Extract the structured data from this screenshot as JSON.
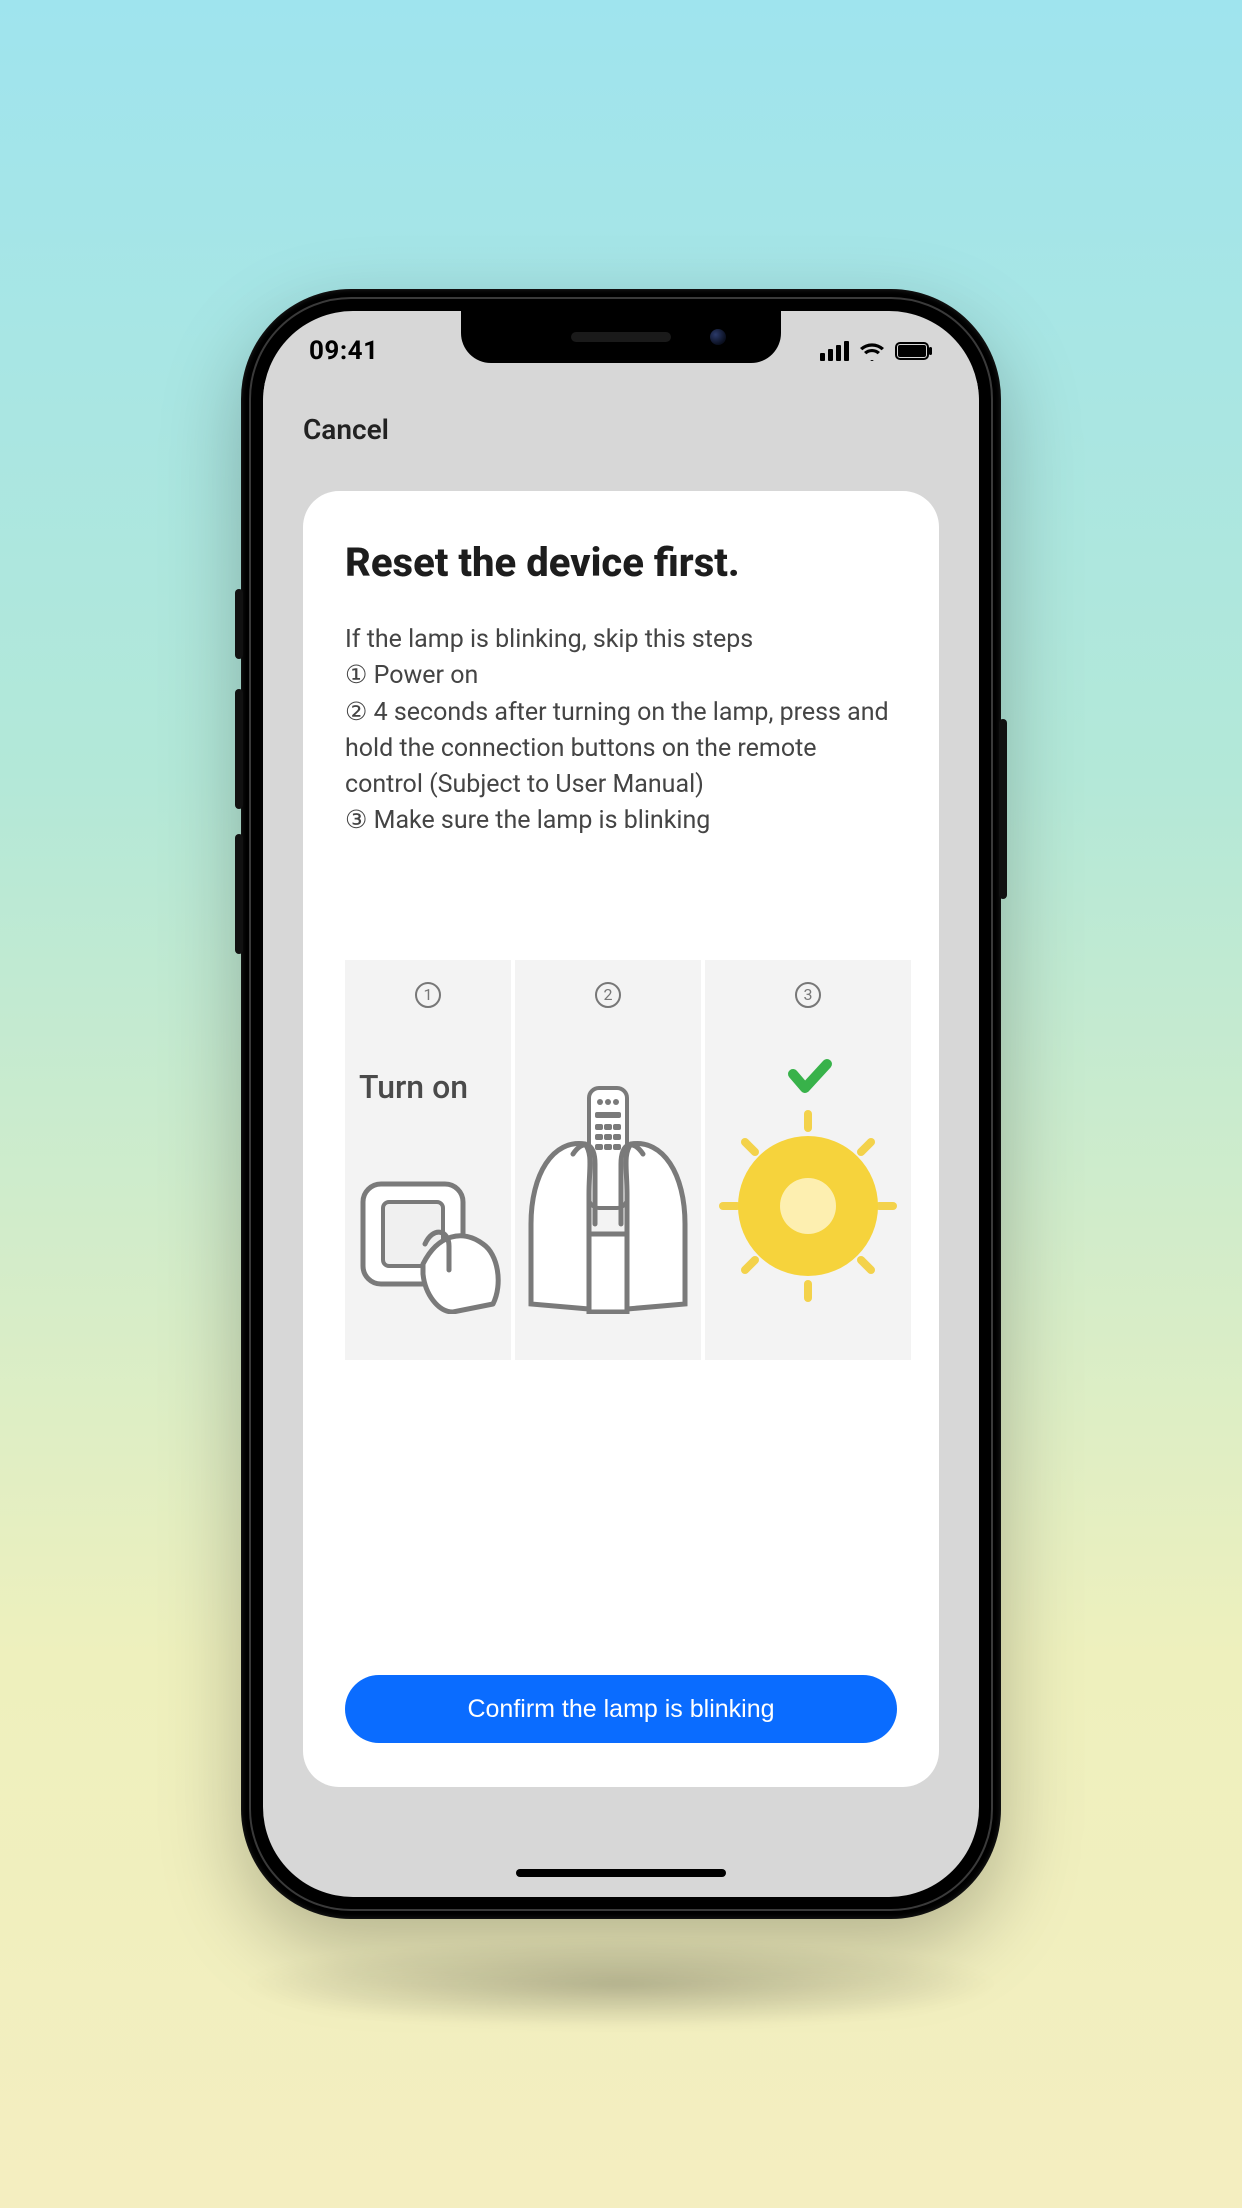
{
  "statusbar": {
    "time": "09:41"
  },
  "nav": {
    "cancel": "Cancel"
  },
  "card": {
    "title": "Reset the device first.",
    "body_line0": "If the lamp is blinking, skip this steps",
    "body_line1": "①  Power on",
    "body_line2": "②  4 seconds after turning on the lamp, press and hold the connection buttons on the remote control (Subject to User Manual)",
    "body_line3": "③  Make sure the lamp is blinking"
  },
  "tiles": {
    "t1": {
      "num": "1",
      "label": "Turn on"
    },
    "t2": {
      "num": "2"
    },
    "t3": {
      "num": "3"
    }
  },
  "confirm": {
    "label": "Confirm the lamp is blinking"
  }
}
